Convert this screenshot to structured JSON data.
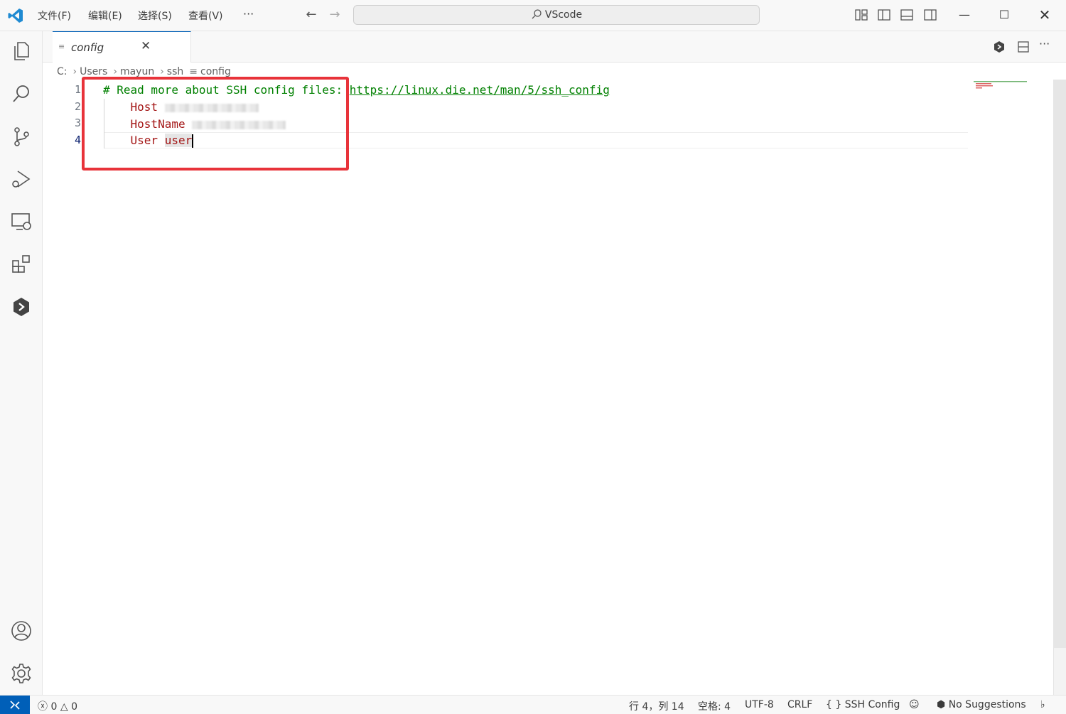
{
  "titlebar": {
    "menus": [
      {
        "label": "文件(F)"
      },
      {
        "label": "编辑(E)"
      },
      {
        "label": "选择(S)"
      },
      {
        "label": "查看(V)"
      }
    ],
    "more_label": "···",
    "search_text": "VScode"
  },
  "tabs": [
    {
      "label": "config"
    }
  ],
  "breadcrumb": [
    "C:",
    "Users",
    "mayun",
    "ssh",
    "config"
  ],
  "editor": {
    "line_numbers": [
      "1",
      "2",
      "3",
      "4"
    ],
    "comment": "# Read more about SSH config files: ",
    "link": "https://linux.die.net/man/5/ssh_config",
    "host_key": "Host",
    "hostname_key": "HostName",
    "user_key": "User",
    "user_value": "user"
  },
  "statusbar": {
    "errors": "0",
    "warnings": "0",
    "position": "行 4，列 14",
    "indent": "空格: 4",
    "encoding": "UTF-8",
    "eol": "CRLF",
    "language": "SSH Config",
    "suggestions": "No Suggestions"
  },
  "colors": {
    "accent": "#005fb8",
    "highlight_box": "#e8333a",
    "comment": "#008000",
    "keyword": "#a31515"
  }
}
